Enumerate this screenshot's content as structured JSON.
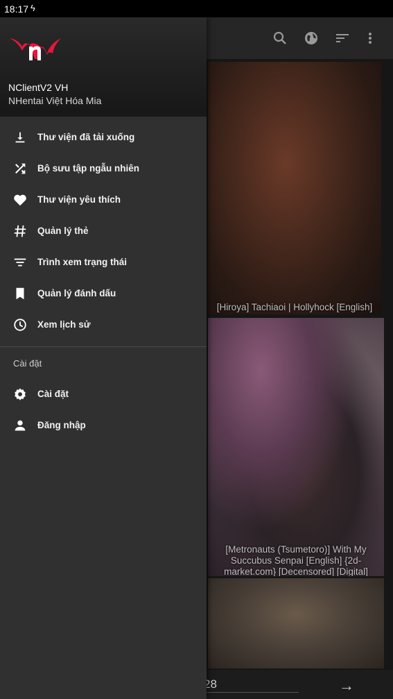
{
  "status_bar": {
    "time": "18:17"
  },
  "drawer": {
    "app_name": "NClientV2 VH",
    "app_subtitle": "NHentai Việt Hóa Mia",
    "items": [
      {
        "label": "Thư viện đã tải xuống",
        "icon": "download-icon"
      },
      {
        "label": "Bộ sưu tập ngẫu nhiên",
        "icon": "shuffle-icon"
      },
      {
        "label": "Thư viện yêu thích",
        "icon": "heart-icon"
      },
      {
        "label": "Quản lý thẻ",
        "icon": "hashtag-icon"
      },
      {
        "label": "Trình xem trạng thái",
        "icon": "filter-icon"
      },
      {
        "label": "Quản lý đánh dấu",
        "icon": "bookmark-icon"
      },
      {
        "label": "Xem lịch sử",
        "icon": "clock-icon"
      }
    ],
    "section_title": "Cài đặt",
    "settings_items": [
      {
        "label": "Cài đặt",
        "icon": "gear-icon"
      },
      {
        "label": "Đăng nhập",
        "icon": "person-icon"
      }
    ]
  },
  "gallery": {
    "cards": [
      {
        "caption": "[Hiroya] Tachiaoi | Hollyhock [English]"
      },
      {
        "caption": "[Metronauts (Tsumetoro)] With My Succubus Senpai [English] {2d-market.com} [Decensored] [Digital]"
      }
    ]
  },
  "pager": {
    "page": "28"
  },
  "colors": {
    "accent": "#e8163c",
    "drawer_bg": "#303030"
  }
}
